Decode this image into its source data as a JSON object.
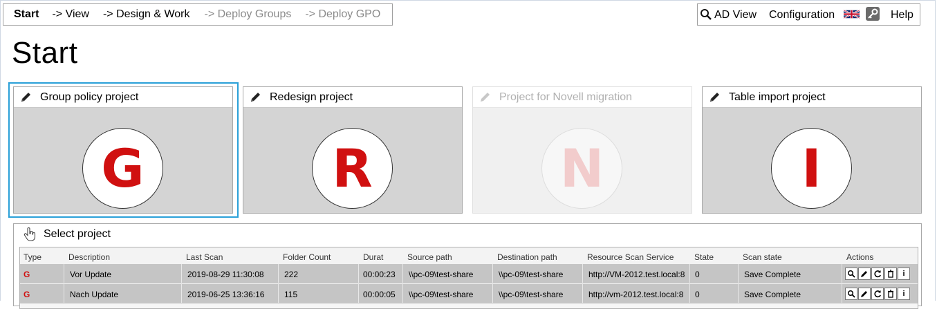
{
  "nav": {
    "items": [
      "Start",
      "-> View",
      "-> Design & Work",
      "-> Deploy Groups",
      "-> Deploy GPO"
    ]
  },
  "toolbar": {
    "ad_view": "AD View",
    "configuration": "Configuration",
    "help": "Help"
  },
  "page": {
    "title": "Start"
  },
  "projects": [
    {
      "label": "Group policy project",
      "letter": "G",
      "enabled": true,
      "selected": true
    },
    {
      "label": "Redesign project",
      "letter": "R",
      "enabled": true,
      "selected": false
    },
    {
      "label": "Project for Novell migration",
      "letter": "N",
      "enabled": false,
      "selected": false
    },
    {
      "label": "Table import project",
      "letter": "I",
      "enabled": true,
      "selected": false
    }
  ],
  "select_panel": {
    "title": "Select project",
    "columns": [
      "Type",
      "Description",
      "Last Scan",
      "Folder Count",
      "Durat",
      "Source path",
      "Destination path",
      "Resource Scan Service",
      "State",
      "Scan state",
      "Actions"
    ],
    "rows": [
      [
        "G",
        "Vor Update",
        "2019-08-29 11:30:08",
        "222",
        "00:00:23",
        "\\\\pc-09\\test-share",
        "\\\\pc-09\\test-share",
        "http://VM-2012.test.local:8",
        "0",
        "Save Complete"
      ],
      [
        "G",
        "Nach Update",
        "2019-06-25 13:36:16",
        "115",
        "00:00:05",
        "\\\\pc-09\\test-share",
        "\\\\pc-09\\test-share",
        "http://vm-2012.test.local:8",
        "0",
        "Save Complete"
      ]
    ]
  },
  "colors": {
    "accent": "#2aa0d8",
    "brand_red": "#d01010"
  }
}
